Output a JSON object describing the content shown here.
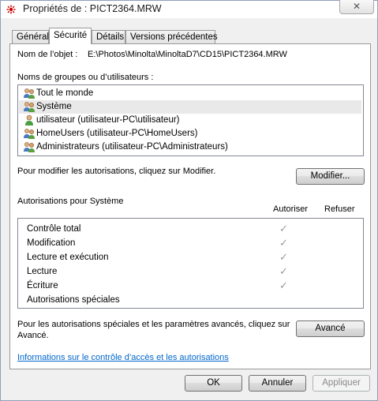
{
  "window": {
    "title": "Propriétés de : PICT2364.MRW",
    "close_label": "✕"
  },
  "tabs": [
    {
      "label": "Général",
      "active": false
    },
    {
      "label": "Sécurité",
      "active": true
    },
    {
      "label": "Détails",
      "active": false
    },
    {
      "label": "Versions précédentes",
      "active": false
    }
  ],
  "security": {
    "object_label": "Nom de l’objet :",
    "object_path": "E:\\Photos\\Minolta\\MinoltaD7\\CD15\\PICT2364.MRW",
    "groups_label": "Noms de groupes ou d’utilisateurs :",
    "groups": [
      {
        "name": "Tout le monde",
        "icon": "group-icon",
        "selected": false
      },
      {
        "name": "Système",
        "icon": "group-icon",
        "selected": true
      },
      {
        "name": "utilisateur (utilisateur-PC\\utilisateur)",
        "icon": "user-icon",
        "selected": false
      },
      {
        "name": "HomeUsers (utilisateur-PC\\HomeUsers)",
        "icon": "group-icon",
        "selected": false
      },
      {
        "name": "Administrateurs (utilisateur-PC\\Administrateurs)",
        "icon": "group-icon",
        "selected": false
      }
    ],
    "modify_hint": "Pour modifier les autorisations, cliquez sur Modifier.",
    "modify_button": "Modifier...",
    "permissions_label": "Autorisations pour Système",
    "allow_header": "Autoriser",
    "deny_header": "Refuser",
    "permissions": [
      {
        "name": "Contrôle total",
        "allow": true,
        "deny": false
      },
      {
        "name": "Modification",
        "allow": true,
        "deny": false
      },
      {
        "name": "Lecture et exécution",
        "allow": true,
        "deny": false
      },
      {
        "name": "Lecture",
        "allow": true,
        "deny": false
      },
      {
        "name": "Écriture",
        "allow": true,
        "deny": false
      },
      {
        "name": "Autorisations spéciales",
        "allow": false,
        "deny": false
      }
    ],
    "check_glyph": "✓",
    "advanced_hint_line1": "Pour les autorisations spéciales et les paramètres avancés, cliquez sur",
    "advanced_hint_line2": "Avancé.",
    "advanced_button": "Avancé",
    "info_link": "Informations sur le contrôle d’accès et les autorisations"
  },
  "footer": {
    "ok": "OK",
    "cancel": "Annuler",
    "apply": "Appliquer"
  },
  "colors": {
    "accent_link": "#0066cc",
    "selection": "#e9e9e9",
    "title_icon": "#cc0000"
  }
}
